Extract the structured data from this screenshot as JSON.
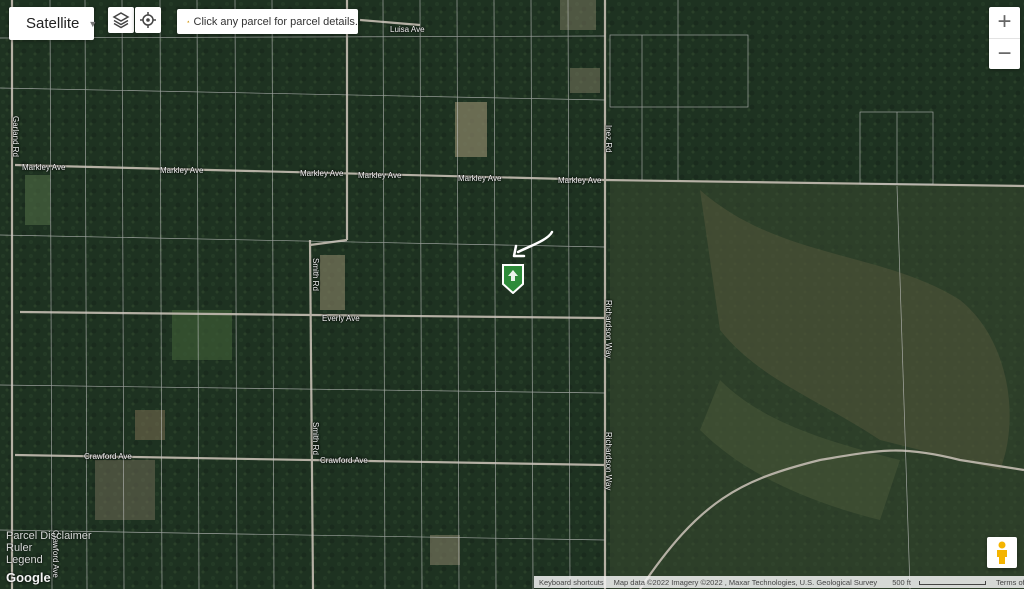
{
  "map_type": {
    "label": "Satellite",
    "arrow_icon": "caret-down-icon"
  },
  "toolbar": {
    "layers_icon": "layers-icon",
    "locate_icon": "crosshair-icon"
  },
  "notice": {
    "icon": "warning-icon",
    "text": "Click any parcel for parcel details."
  },
  "zoom": {
    "in_label": "+",
    "out_label": "−"
  },
  "roads": {
    "luisa": "Luisa Ave",
    "garland": "Garland Rd",
    "markley_1": "Markley Ave",
    "markley_2": "Markley Ave",
    "markley_3": "Markley Ave",
    "markley_4": "Markley Ave",
    "markley_5": "Markley Ave",
    "inez": "Inez Rd",
    "smith_1": "Smith Rd",
    "smith_2": "Smith Rd",
    "everly": "Everly Ave",
    "richardson_1": "Richardson Way",
    "richardson_2": "Richardson Way",
    "crawford_1": "Crawford Ave",
    "crawford_2": "Crawford Ave",
    "crawford_3": "Crawford Ave"
  },
  "left_links": [
    "Parcel Disclaimer",
    "Ruler",
    "Legend"
  ],
  "logo": "Google",
  "attribution": {
    "keyboard": "Keyboard shortcuts",
    "map_data": "Map data ©2022 Imagery ©2022 , Maxar Technologies, U.S. Geological Survey",
    "scale": "500 ft",
    "terms": "Terms of Use"
  },
  "marker": {
    "icon": "parcel-marker-icon",
    "color": "#2e8b3a"
  },
  "colors": {
    "forest": "#1f3322",
    "parcel_line": "#c8c8c8",
    "road": "#b5b0a4"
  }
}
